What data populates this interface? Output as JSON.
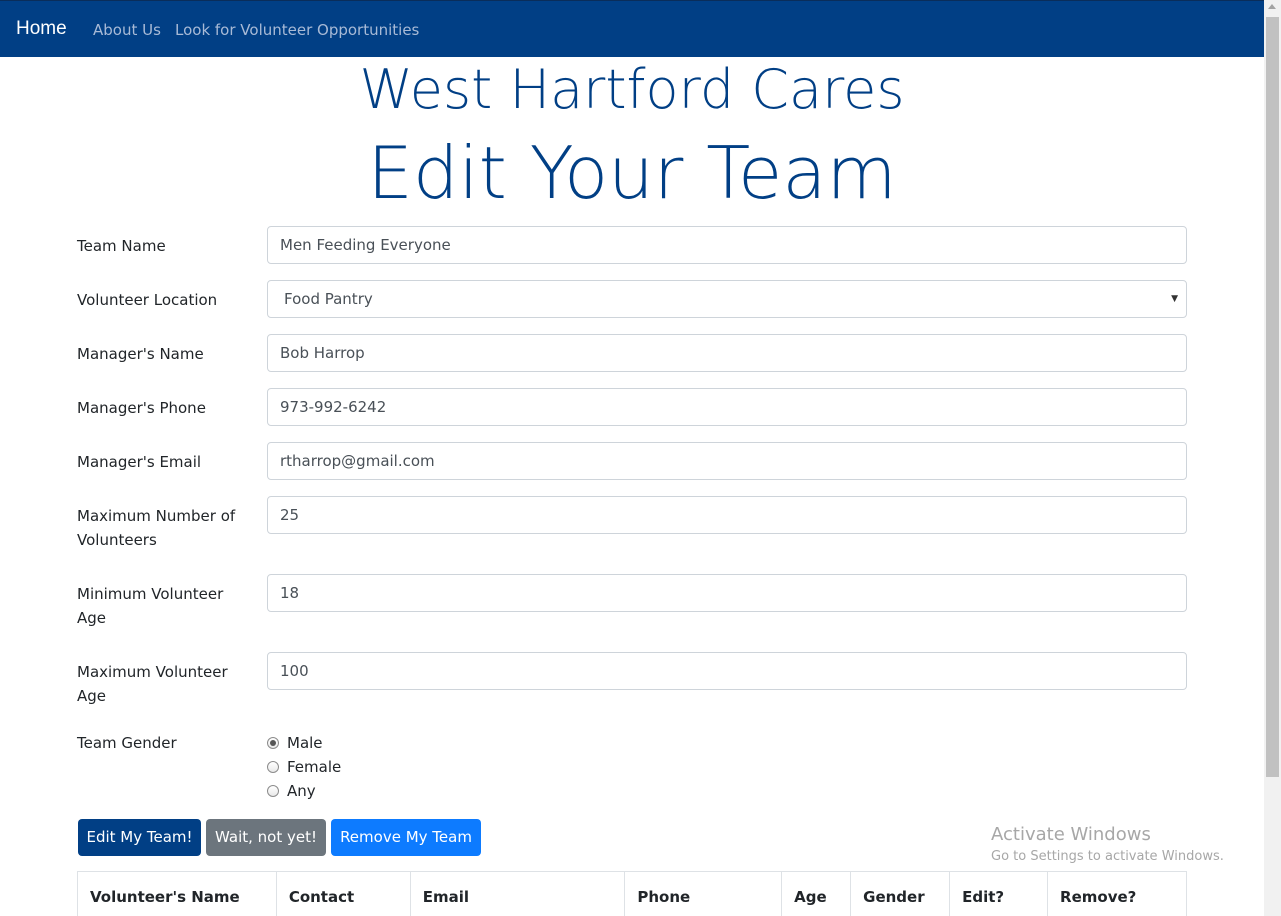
{
  "navbar": {
    "brand": "Home",
    "links": [
      "About Us",
      "Look for Volunteer Opportunities"
    ],
    "background": "#013f85"
  },
  "header": {
    "site_title": "West Hartford Cares",
    "page_title": "Edit Your Team"
  },
  "form": {
    "team_name": {
      "label": "Team Name",
      "value": "Men Feeding Everyone"
    },
    "volunteer_location": {
      "label": "Volunteer Location",
      "selected": "Food Pantry"
    },
    "manager_name": {
      "label": "Manager's Name",
      "value": "Bob Harrop"
    },
    "manager_phone": {
      "label": "Manager's Phone",
      "value": "973-992-6242"
    },
    "manager_email": {
      "label": "Manager's Email",
      "value": "rtharrop@gmail.com"
    },
    "max_volunteers": {
      "label": "Maximum Number of Volunteers",
      "value": "25"
    },
    "min_age": {
      "label": "Minimum Volunteer Age",
      "value": "18"
    },
    "max_age": {
      "label": "Maximum Volunteer Age",
      "value": "100"
    },
    "team_gender": {
      "label": "Team Gender",
      "options": [
        "Male",
        "Female",
        "Any"
      ],
      "selected": "Male"
    }
  },
  "buttons": {
    "edit": "Edit My Team!",
    "wait": "Wait, not yet!",
    "remove": "Remove My Team"
  },
  "table": {
    "headers": [
      "Volunteer's Name",
      "Contact",
      "Email",
      "Phone",
      "Age",
      "Gender",
      "Edit?",
      "Remove?"
    ]
  },
  "watermark": {
    "line1": "Activate Windows",
    "line2": "Go to Settings to activate Windows."
  },
  "colors": {
    "primary": "#013f85",
    "secondary": "#6c757d",
    "accent": "#0d7bff"
  }
}
